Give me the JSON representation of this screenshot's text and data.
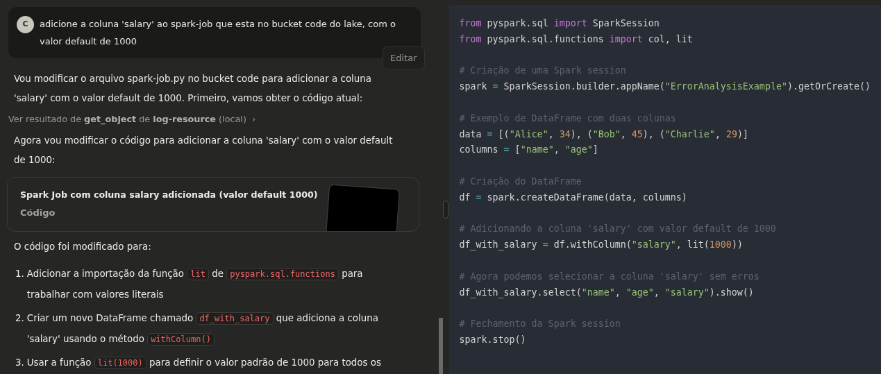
{
  "user_message": {
    "avatar": "C",
    "text": "adicione a coluna 'salary' ao spark-job que esta no bucket code do lake, com o valor default de 1000",
    "edit_label": "Editar"
  },
  "chat": [
    {
      "kind": "paragraph",
      "text": "Vou modificar o arquivo spark-job.py no bucket code para adicionar a coluna 'salary' com o valor default de 1000. Primeiro, vamos obter o código atual:"
    },
    {
      "kind": "tool_result",
      "text": "Ver resultado de **get_object** de **log-resource** (local)",
      "chevron": "›"
    },
    {
      "kind": "paragraph",
      "text": "Agora vou modificar o código para adicionar a coluna 'salary' com o valor default de 1000:"
    },
    {
      "kind": "artifact",
      "title": "Spark Job com coluna salary adicionada (valor default 1000)",
      "subtitle": "Código"
    },
    {
      "kind": "paragraph",
      "text": "O código foi modificado para:"
    },
    {
      "kind": "list",
      "items": [
        {
          "number": "1.",
          "segments": [
            {
              "kind": "text",
              "text": "Adicionar a importação da função "
            },
            {
              "kind": "code",
              "text": "lit"
            },
            {
              "kind": "text",
              "text": " de "
            },
            {
              "kind": "code",
              "text": "pyspark.sql.functions"
            },
            {
              "kind": "text",
              "text": " para trabalhar com valores literais"
            }
          ]
        },
        {
          "number": "2.",
          "segments": [
            {
              "kind": "text",
              "text": "Criar um novo DataFrame chamado "
            },
            {
              "kind": "code",
              "text": "df_with_salary"
            },
            {
              "kind": "text",
              "text": " que adiciona a coluna 'salary' usando o método "
            },
            {
              "kind": "code",
              "text": "withColumn()"
            }
          ]
        },
        {
          "number": "3.",
          "segments": [
            {
              "kind": "text",
              "text": "Usar a função "
            },
            {
              "kind": "code",
              "text": "lit(1000)"
            },
            {
              "kind": "text",
              "text": " para definir o valor padrão de 1000 para todos os"
            }
          ]
        }
      ]
    }
  ],
  "code": [
    {
      "lines": [
        [
          {
            "kind": "keyword",
            "text": "from"
          },
          {
            "kind": "plain",
            "text": " pyspark.sql "
          },
          {
            "kind": "keyword",
            "text": "import"
          },
          {
            "kind": "plain",
            "text": " SparkSession"
          }
        ],
        [
          {
            "kind": "keyword",
            "text": "from"
          },
          {
            "kind": "plain",
            "text": " pyspark.sql.functions "
          },
          {
            "kind": "keyword",
            "text": "import"
          },
          {
            "kind": "plain",
            "text": " col, lit"
          }
        ]
      ]
    },
    {
      "lines": [
        [
          {
            "kind": "comment",
            "text": "# Criação de uma Spark session"
          }
        ],
        [
          {
            "kind": "plain",
            "text": "spark "
          },
          {
            "kind": "operator",
            "text": "="
          },
          {
            "kind": "plain",
            "text": " SparkSession.builder.appName("
          },
          {
            "kind": "string",
            "text": "\"ErrorAnalysisExample\""
          },
          {
            "kind": "plain",
            "text": ").getOrCreate()"
          }
        ]
      ]
    },
    {
      "lines": [
        [
          {
            "kind": "comment",
            "text": "# Exemplo de DataFrame com duas colunas"
          }
        ],
        [
          {
            "kind": "plain",
            "text": "data "
          },
          {
            "kind": "operator",
            "text": "="
          },
          {
            "kind": "plain",
            "text": " [("
          },
          {
            "kind": "string",
            "text": "\"Alice\""
          },
          {
            "kind": "plain",
            "text": ", "
          },
          {
            "kind": "number",
            "text": "34"
          },
          {
            "kind": "plain",
            "text": "), ("
          },
          {
            "kind": "string",
            "text": "\"Bob\""
          },
          {
            "kind": "plain",
            "text": ", "
          },
          {
            "kind": "number",
            "text": "45"
          },
          {
            "kind": "plain",
            "text": "), ("
          },
          {
            "kind": "string",
            "text": "\"Charlie\""
          },
          {
            "kind": "plain",
            "text": ", "
          },
          {
            "kind": "number",
            "text": "29"
          },
          {
            "kind": "plain",
            "text": ")]"
          }
        ],
        [
          {
            "kind": "plain",
            "text": "columns "
          },
          {
            "kind": "operator",
            "text": "="
          },
          {
            "kind": "plain",
            "text": " ["
          },
          {
            "kind": "string",
            "text": "\"name\""
          },
          {
            "kind": "plain",
            "text": ", "
          },
          {
            "kind": "string",
            "text": "\"age\""
          },
          {
            "kind": "plain",
            "text": "]"
          }
        ]
      ]
    },
    {
      "lines": [
        [
          {
            "kind": "comment",
            "text": "# Criação do DataFrame"
          }
        ],
        [
          {
            "kind": "plain",
            "text": "df "
          },
          {
            "kind": "operator",
            "text": "="
          },
          {
            "kind": "plain",
            "text": " spark.createDataFrame(data, columns)"
          }
        ]
      ]
    },
    {
      "lines": [
        [
          {
            "kind": "comment",
            "text": "# Adicionando a coluna 'salary' com valor default de 1000"
          }
        ],
        [
          {
            "kind": "plain",
            "text": "df_with_salary "
          },
          {
            "kind": "operator",
            "text": "="
          },
          {
            "kind": "plain",
            "text": " df.withColumn("
          },
          {
            "kind": "string",
            "text": "\"salary\""
          },
          {
            "kind": "plain",
            "text": ", lit("
          },
          {
            "kind": "number",
            "text": "1000"
          },
          {
            "kind": "plain",
            "text": "))"
          }
        ]
      ]
    },
    {
      "lines": [
        [
          {
            "kind": "comment",
            "text": "# Agora podemos selecionar a coluna 'salary' sem erros"
          }
        ],
        [
          {
            "kind": "plain",
            "text": "df_with_salary.select("
          },
          {
            "kind": "string",
            "text": "\"name\""
          },
          {
            "kind": "plain",
            "text": ", "
          },
          {
            "kind": "string",
            "text": "\"age\""
          },
          {
            "kind": "plain",
            "text": ", "
          },
          {
            "kind": "string",
            "text": "\"salary\""
          },
          {
            "kind": "plain",
            "text": ").show()"
          }
        ]
      ]
    },
    {
      "lines": [
        [
          {
            "kind": "comment",
            "text": "# Fechamento da Spark session"
          }
        ],
        [
          {
            "kind": "plain",
            "text": "spark.stop()"
          }
        ]
      ]
    }
  ]
}
